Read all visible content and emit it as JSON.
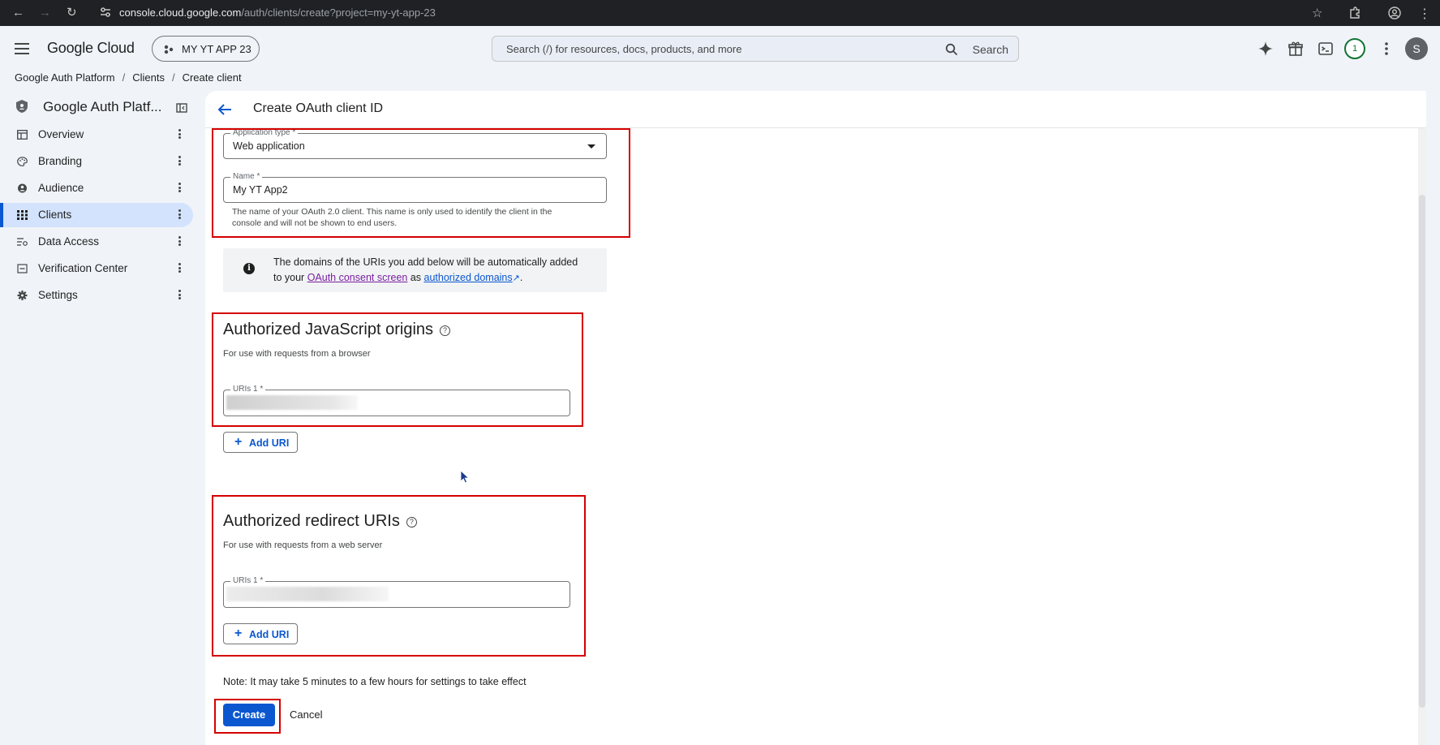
{
  "browser": {
    "url_host": "console.cloud.google.com",
    "url_path": "/auth/clients/create?project=my-yt-app-23"
  },
  "header": {
    "brand": "Google Cloud",
    "project": "MY YT APP 23",
    "search_placeholder": "Search (/) for resources, docs, products, and more",
    "search_button": "Search",
    "notification_count": "1",
    "avatar_letter": "S"
  },
  "breadcrumb": [
    "Google Auth Platform",
    "Clients",
    "Create client"
  ],
  "sidebar": {
    "title": "Google Auth Platf...",
    "items": [
      {
        "label": "Overview",
        "icon": "dashboard-icon"
      },
      {
        "label": "Branding",
        "icon": "palette-icon"
      },
      {
        "label": "Audience",
        "icon": "person-icon"
      },
      {
        "label": "Clients",
        "icon": "grid-icon",
        "active": true
      },
      {
        "label": "Data Access",
        "icon": "data-access-icon"
      },
      {
        "label": "Verification Center",
        "icon": "verification-icon"
      },
      {
        "label": "Settings",
        "icon": "gear-icon"
      }
    ]
  },
  "main": {
    "title": "Create OAuth client ID",
    "app_type": {
      "label": "Application type *",
      "value": "Web application"
    },
    "name": {
      "label": "Name *",
      "value": "My YT App2",
      "hint_line1": "The name of your OAuth 2.0 client. This name is only used to identify the client in the",
      "hint_line2": "console and will not be shown to end users."
    },
    "info": {
      "text1": "The domains of the URIs you add below will be automatically added",
      "text2_pre": "to your ",
      "link1": "OAuth consent screen",
      "text2_mid": " as ",
      "link2": "authorized domains",
      "text2_post": "."
    },
    "js_origins": {
      "title": "Authorized JavaScript origins",
      "subtitle": "For use with requests from a browser",
      "uri_label": "URIs 1 *",
      "add_label": "Add URI"
    },
    "redirect_uris": {
      "title": "Authorized redirect URIs",
      "subtitle": "For use with requests from a web server",
      "uri_label": "URIs 1 *",
      "add_label": "Add URI"
    },
    "note": "Note: It may take 5 minutes to a few hours for settings to take effect",
    "create_label": "Create",
    "cancel_label": "Cancel"
  },
  "colors": {
    "accent": "#0b57d0",
    "highlight_box": "#d50000",
    "active_nav": "#d3e3fd"
  }
}
